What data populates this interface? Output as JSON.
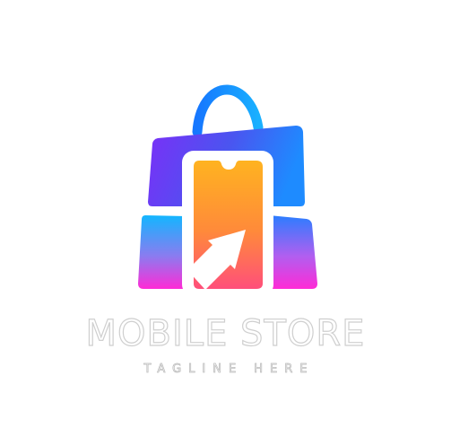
{
  "logo": {
    "icon": "shopping-bag-with-phone-and-arrow-icon",
    "name": "MOBILE STORE",
    "tagline": "TAGLINE HERE"
  },
  "colors": {
    "background": "#ffffff",
    "bag_top_left": "#7b2ff7",
    "bag_top_right": "#1e88ff",
    "bag_bottom_top": "#19b4ff",
    "bag_bottom_bottom": "#ff2bd6",
    "handle": "#1e8bff",
    "phone_top": "#ffb31f",
    "phone_bottom": "#ff4d7a",
    "text_outline": "#cfcfcf"
  }
}
